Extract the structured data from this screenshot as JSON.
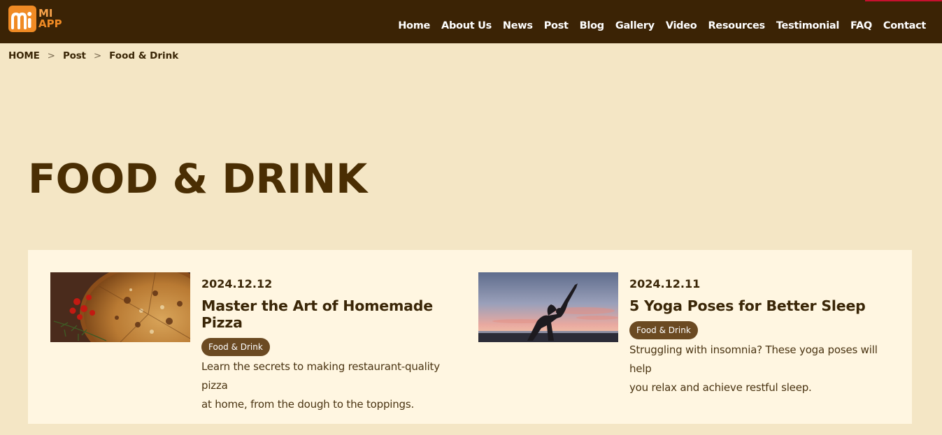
{
  "header": {
    "logo_text_line1": "MI",
    "logo_text_line2": "APP",
    "nav": [
      "Home",
      "About Us",
      "News",
      "Post",
      "Blog",
      "Gallery",
      "Video",
      "Resources",
      "Testimonial",
      "FAQ",
      "Contact"
    ]
  },
  "breadcrumb": {
    "home": "HOME",
    "sep": ">",
    "post": "Post",
    "current": "Food & Drink"
  },
  "page_title": "FOOD & DRINK",
  "posts": [
    {
      "date": "2024.12.12",
      "title": "Master the Art of Homemade Pizza",
      "tag": "Food & Drink",
      "excerpt_line1": "Learn the secrets to making restaurant-quality pizza",
      "excerpt_line2": "at home, from the dough to the toppings.",
      "image": "pizza-photo"
    },
    {
      "date": "2024.12.11",
      "title": "5 Yoga Poses for Better Sleep",
      "tag": "Food & Drink",
      "excerpt_line1": "Struggling with insomnia? These yoga poses will help",
      "excerpt_line2": "you relax and achieve restful sleep.",
      "image": "yoga-sunset-photo"
    }
  ],
  "colors": {
    "header_bg": "#3b2305",
    "page_bg": "#f4e6c5",
    "panel_bg": "#fff6e1",
    "accent_orange": "#f08a24",
    "tag_bg": "#6b4a22",
    "text_dark": "#3a2607"
  }
}
